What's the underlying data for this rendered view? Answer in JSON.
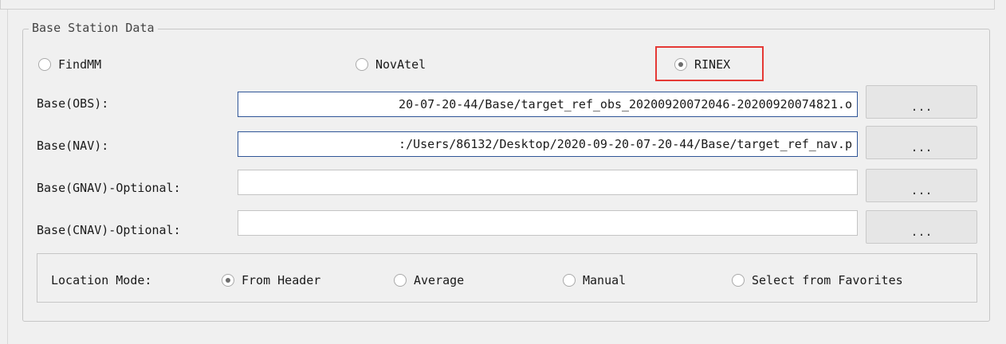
{
  "group_title": "Base Station Data",
  "source_options": [
    {
      "label": "FindMM",
      "selected": false
    },
    {
      "label": "NovAtel",
      "selected": false
    },
    {
      "label": "RINEX",
      "selected": true
    }
  ],
  "fields": [
    {
      "label": "Base(OBS):",
      "value": "20-07-20-44/Base/target_ref_obs_20200920072046-20200920074821.o",
      "button": "..."
    },
    {
      "label": "Base(NAV):",
      "value": ":/Users/86132/Desktop/2020-09-20-07-20-44/Base/target_ref_nav.p",
      "button": "..."
    },
    {
      "label": "Base(GNAV)-Optional:",
      "value": "",
      "button": "..."
    },
    {
      "label": "Base(CNAV)-Optional:",
      "value": "",
      "button": "..."
    }
  ],
  "location": {
    "label": "Location Mode:",
    "options": [
      {
        "label": "From Header",
        "selected": true
      },
      {
        "label": "Average",
        "selected": false
      },
      {
        "label": "Manual",
        "selected": false
      },
      {
        "label": "Select from Favorites",
        "selected": false
      }
    ]
  },
  "colors": {
    "highlight": "#e53935",
    "focus_border": "#2f5597"
  }
}
